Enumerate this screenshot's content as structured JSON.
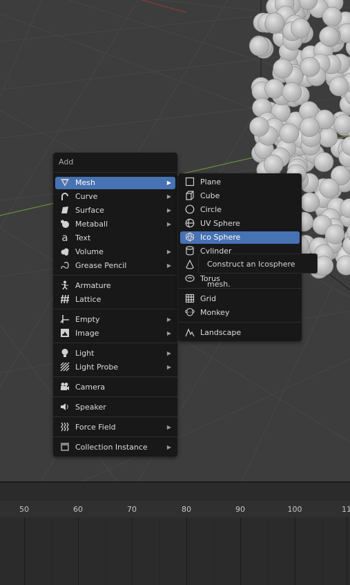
{
  "add_menu": {
    "title": "Add",
    "items": [
      {
        "label": "Mesh",
        "icon": "mesh-icon",
        "submenu": true,
        "active": true
      },
      {
        "label": "Curve",
        "icon": "curve-icon",
        "submenu": true
      },
      {
        "label": "Surface",
        "icon": "surface-icon",
        "submenu": true
      },
      {
        "label": "Metaball",
        "icon": "metaball-icon",
        "submenu": true
      },
      {
        "label": "Text",
        "icon": "text-icon",
        "submenu": false
      },
      {
        "label": "Volume",
        "icon": "volume-icon",
        "submenu": true
      },
      {
        "label": "Grease Pencil",
        "icon": "grease-pencil-icon",
        "submenu": true
      },
      {
        "label": "Armature",
        "icon": "armature-icon",
        "submenu": false
      },
      {
        "label": "Lattice",
        "icon": "lattice-icon",
        "submenu": false
      },
      {
        "label": "Empty",
        "icon": "empty-icon",
        "submenu": true
      },
      {
        "label": "Image",
        "icon": "image-icon",
        "submenu": true
      },
      {
        "label": "Light",
        "icon": "light-icon",
        "submenu": true
      },
      {
        "label": "Light Probe",
        "icon": "light-probe-icon",
        "submenu": true
      },
      {
        "label": "Camera",
        "icon": "camera-icon",
        "submenu": false
      },
      {
        "label": "Speaker",
        "icon": "speaker-icon",
        "submenu": false
      },
      {
        "label": "Force Field",
        "icon": "force-field-icon",
        "submenu": true
      },
      {
        "label": "Collection Instance",
        "icon": "collection-icon",
        "submenu": true
      }
    ]
  },
  "mesh_submenu": {
    "items": [
      {
        "label": "Plane",
        "icon": "plane-icon"
      },
      {
        "label": "Cube",
        "icon": "cube-icon"
      },
      {
        "label": "Circle",
        "icon": "circle-icon"
      },
      {
        "label": "UV Sphere",
        "icon": "uv-sphere-icon"
      },
      {
        "label": "Ico Sphere",
        "icon": "ico-sphere-icon",
        "active": true
      },
      {
        "label": "Cylinder",
        "icon": "cylinder-icon"
      },
      {
        "label": "Cone",
        "icon": "cone-icon"
      },
      {
        "label": "Torus",
        "icon": "torus-icon"
      },
      {
        "label": "Grid",
        "icon": "grid-icon"
      },
      {
        "label": "Monkey",
        "icon": "monkey-icon"
      },
      {
        "label": "Landscape",
        "icon": "landscape-icon"
      }
    ]
  },
  "tooltip": {
    "text": "Construct an Icosphere mesh."
  },
  "timeline": {
    "frames": [
      "50",
      "60",
      "70",
      "80",
      "90",
      "100",
      "11"
    ]
  },
  "colors": {
    "highlight": "#4772b3",
    "menu_bg": "#181818",
    "viewport_bg": "#3d3d3d"
  }
}
